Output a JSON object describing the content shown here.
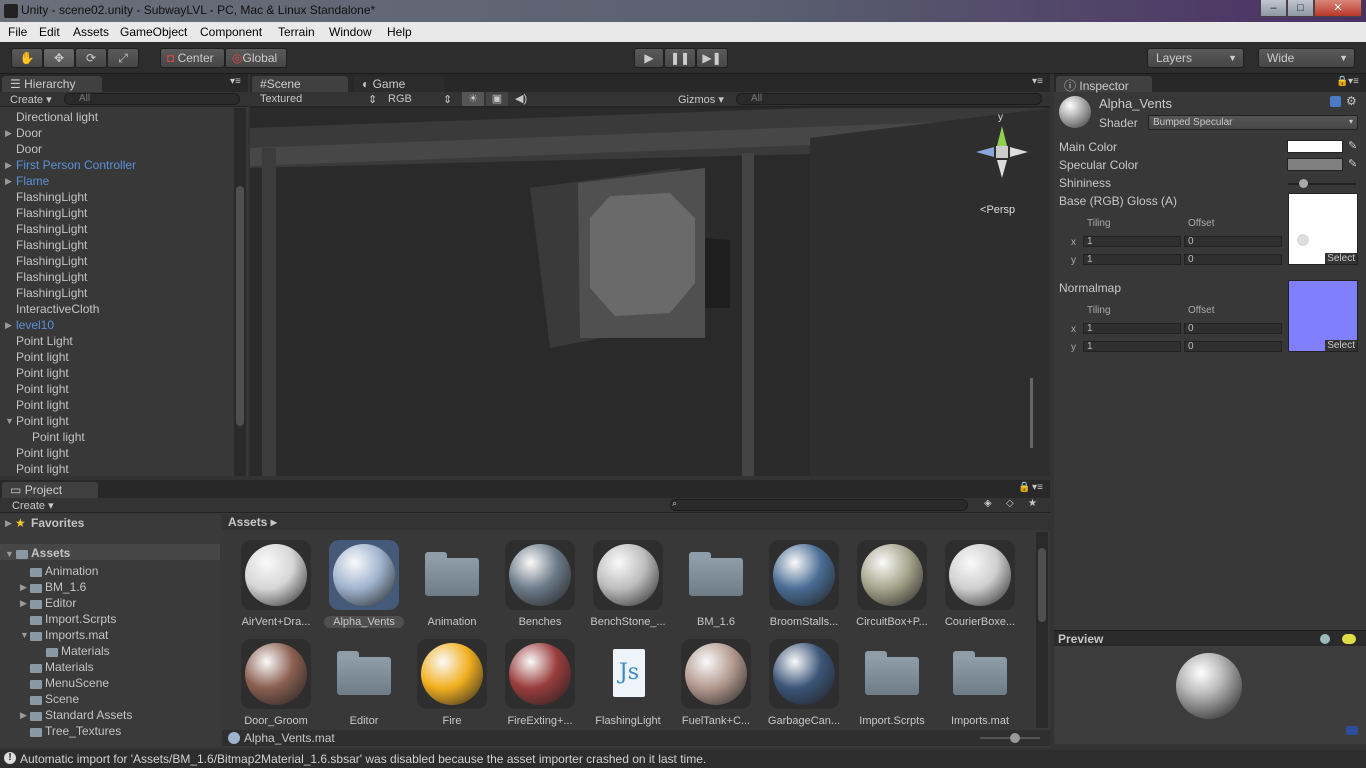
{
  "window": {
    "title": "Unity - scene02.unity - SubwayLVL - PC, Mac & Linux Standalone*",
    "minimize": "‒",
    "maximize": "□",
    "close": "✕"
  },
  "menubar": [
    "File",
    "Edit",
    "Assets",
    "GameObject",
    "Component",
    "Terrain",
    "Window",
    "Help"
  ],
  "toolbar": {
    "pivot": "Center",
    "space": "Global",
    "layers": "Layers",
    "layout": "Wide"
  },
  "hierarchy": {
    "tab": "Hierarchy",
    "create": "Create",
    "search_placeholder": "All",
    "items": [
      {
        "label": "Directional light",
        "arrow": false,
        "prefab": false
      },
      {
        "label": "Door",
        "arrow": true,
        "prefab": false
      },
      {
        "label": "Door",
        "arrow": false,
        "prefab": false
      },
      {
        "label": "First Person Controller",
        "arrow": true,
        "prefab": true
      },
      {
        "label": "Flame",
        "arrow": true,
        "prefab": true
      },
      {
        "label": "FlashingLight",
        "arrow": false,
        "prefab": false
      },
      {
        "label": "FlashingLight",
        "arrow": false,
        "prefab": false
      },
      {
        "label": "FlashingLight",
        "arrow": false,
        "prefab": false
      },
      {
        "label": "FlashingLight",
        "arrow": false,
        "prefab": false
      },
      {
        "label": "FlashingLight",
        "arrow": false,
        "prefab": false
      },
      {
        "label": "FlashingLight",
        "arrow": false,
        "prefab": false
      },
      {
        "label": "FlashingLight",
        "arrow": false,
        "prefab": false
      },
      {
        "label": "InteractiveCloth",
        "arrow": false,
        "prefab": false
      },
      {
        "label": "level10",
        "arrow": true,
        "prefab": true
      },
      {
        "label": "Point Light",
        "arrow": false,
        "prefab": false
      },
      {
        "label": "Point light",
        "arrow": false,
        "prefab": false
      },
      {
        "label": "Point light",
        "arrow": false,
        "prefab": false
      },
      {
        "label": "Point light",
        "arrow": false,
        "prefab": false
      },
      {
        "label": "Point light",
        "arrow": false,
        "prefab": false
      },
      {
        "label": "Point light",
        "arrow": true,
        "prefab": false
      },
      {
        "label": "Point light",
        "arrow": false,
        "prefab": false
      },
      {
        "label": "Point light",
        "arrow": false,
        "prefab": false
      },
      {
        "label": "Point light",
        "arrow": false,
        "prefab": false
      }
    ]
  },
  "scene": {
    "tab_scene": "Scene",
    "tab_game": "Game",
    "render_mode": "Textured",
    "color_mode": "RGB",
    "gizmos": "Gizmos",
    "search_placeholder": "All",
    "view_label": "Persp",
    "axis_y": "y"
  },
  "inspector": {
    "tab": "Inspector",
    "material_name": "Alpha_Vents",
    "shader_label": "Shader",
    "shader_value": "Bumped Specular",
    "main_color": "Main Color",
    "specular_color": "Specular Color",
    "shininess": "Shininess",
    "shininess_level": 0.08,
    "base_label": "Base (RGB) Gloss (A)",
    "tiling": "Tiling",
    "offset": "Offset",
    "base_x_tiling": "1",
    "base_x_offset": "0",
    "base_y_tiling": "1",
    "base_y_offset": "0",
    "normalmap": "Normalmap",
    "norm_x_tiling": "1",
    "norm_x_offset": "0",
    "norm_y_tiling": "1",
    "norm_y_offset": "0",
    "x": "x",
    "y": "y",
    "select": "Select",
    "colors": {
      "main": "#ffffff",
      "specular": "#808080",
      "normal": "#8080ff"
    }
  },
  "preview": {
    "title": "Preview"
  },
  "project": {
    "tab": "Project",
    "create": "Create",
    "favorites": "Favorites",
    "assets_root": "Assets",
    "breadcrumb": "Assets",
    "tree": [
      "Animation",
      "BM_1.6",
      "Editor",
      "Import.Scrpts",
      "Imports.mat",
      "Materials",
      "Materials",
      "MenuScene",
      "Scene",
      "Standard Assets",
      "Tree_Textures"
    ],
    "assets": [
      {
        "label": "AirVent+Dra...",
        "kind": "ball",
        "color": "#d6d6d6"
      },
      {
        "label": "Alpha_Vents",
        "kind": "ball",
        "color": "#9fb3cf"
      },
      {
        "label": "Animation",
        "kind": "folder"
      },
      {
        "label": "Benches",
        "kind": "ball",
        "color": "#6c7a88"
      },
      {
        "label": "BenchStone_...",
        "kind": "ball",
        "color": "#bdbdbd"
      },
      {
        "label": "BM_1.6",
        "kind": "folder"
      },
      {
        "label": "BroomStalls...",
        "kind": "ball",
        "color": "#4a6d95"
      },
      {
        "label": "CircuitBox+P...",
        "kind": "ball",
        "color": "#a6a58c"
      },
      {
        "label": "CourierBoxe...",
        "kind": "ball",
        "color": "#cfcfcf"
      },
      {
        "label": "Door_Groom",
        "kind": "ball",
        "color": "#8a5f50"
      },
      {
        "label": "Editor",
        "kind": "folder"
      },
      {
        "label": "Fire",
        "kind": "ball",
        "color": "#f2b020"
      },
      {
        "label": "FireExting+...",
        "kind": "ball",
        "color": "#9a3c3c"
      },
      {
        "label": "FlashingLight",
        "kind": "script",
        "glyph": "Js"
      },
      {
        "label": "FuelTank+C...",
        "kind": "ball",
        "color": "#b49a90"
      },
      {
        "label": "GarbageCan...",
        "kind": "ball",
        "color": "#3b5578"
      },
      {
        "label": "Import.Scrpts",
        "kind": "folder"
      },
      {
        "label": "Imports.mat",
        "kind": "folder"
      }
    ],
    "selected_file": "Alpha_Vents.mat"
  },
  "status": {
    "message": "Automatic import for 'Assets/BM_1.6/Bitmap2Material_1.6.sbsar' was disabled because the asset importer crashed on it last time."
  }
}
